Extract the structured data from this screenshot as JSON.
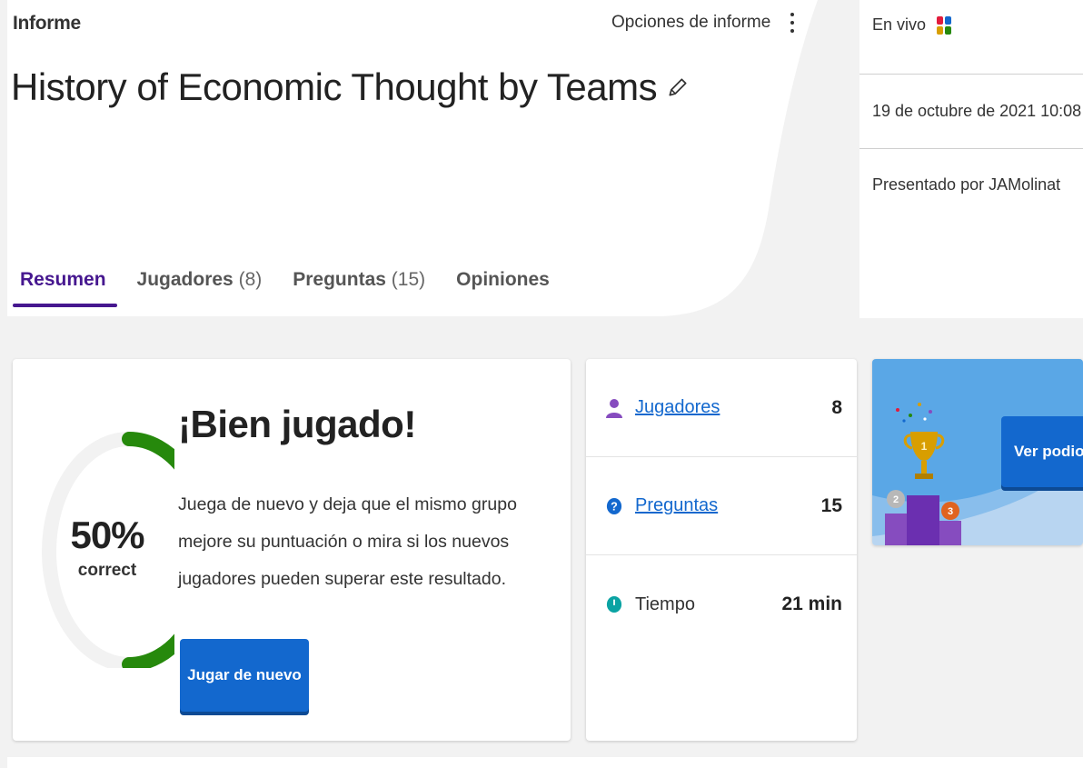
{
  "header": {
    "report_label": "Informe",
    "options_label": "Opciones de informe",
    "title": "History of Economic Thought by Teams"
  },
  "tabs": [
    {
      "label": "Resumen",
      "count": "",
      "active": true
    },
    {
      "label": "Jugadores",
      "count": "(8)",
      "active": false
    },
    {
      "label": "Preguntas",
      "count": "(15)",
      "active": false
    },
    {
      "label": "Opiniones",
      "count": "",
      "active": false
    }
  ],
  "info": {
    "mode": "En vivo",
    "date": "19 de octubre de 2021 10:08",
    "host": "Presentado por JAMolinat"
  },
  "summary": {
    "percent": "50%",
    "percent_value": 0.5,
    "percent_label": "correct",
    "heading": "¡Bien jugado!",
    "body": "Juega de nuevo y deja que el mismo grupo mejore su puntuación o mira si los nuevos jugadores pueden superar este resultado.",
    "play_again": "Jugar de nuevo"
  },
  "stats": [
    {
      "label": "Jugadores",
      "value": "8",
      "icon": "player-icon"
    },
    {
      "label": "Preguntas",
      "value": "15",
      "icon": "question-icon"
    },
    {
      "label": "Tiempo",
      "value": "21 min",
      "icon": "clock-icon"
    }
  ],
  "podium": {
    "button": "Ver podio"
  },
  "colors": {
    "accent_purple": "#46178f",
    "primary_blue": "#1368ce",
    "correct_green": "#26890c"
  }
}
